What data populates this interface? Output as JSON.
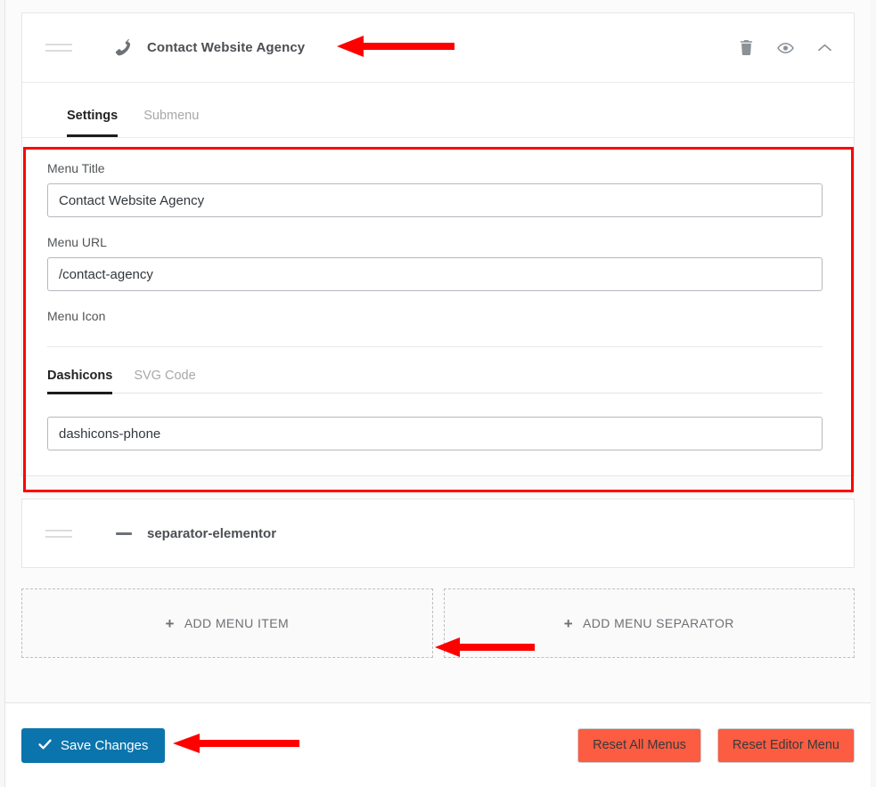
{
  "menu_item": {
    "title": "Contact Website Agency",
    "icon": "phone-icon",
    "actions": {
      "delete": "trash-icon",
      "visibility": "eye-icon",
      "collapse": "chevron-up-icon"
    },
    "tabs": [
      {
        "label": "Settings",
        "active": true
      },
      {
        "label": "Submenu",
        "active": false
      }
    ],
    "fields": {
      "menu_title_label": "Menu Title",
      "menu_title_value": "Contact Website Agency",
      "menu_url_label": "Menu URL",
      "menu_url_value": "/contact-agency",
      "menu_icon_label": "Menu Icon",
      "icon_tabs": [
        {
          "label": "Dashicons",
          "active": true
        },
        {
          "label": "SVG Code",
          "active": false
        }
      ],
      "icon_value": "dashicons-phone"
    }
  },
  "separator_item": {
    "title": "separator-elementor",
    "icon": "dash-icon"
  },
  "add_buttons": {
    "add_menu_item": "ADD MENU ITEM",
    "add_menu_separator": "ADD MENU SEPARATOR",
    "plus": "+"
  },
  "footer": {
    "save_label": "Save Changes",
    "save_icon": "check-icon",
    "reset_all_label": "Reset All Menus",
    "reset_editor_label": "Reset Editor Menu"
  },
  "colors": {
    "accent_blue": "#0c74ac",
    "reset_orange": "#fb5c42",
    "annotation_red": "#ff0000",
    "active_tab": "#1d1d1d"
  }
}
